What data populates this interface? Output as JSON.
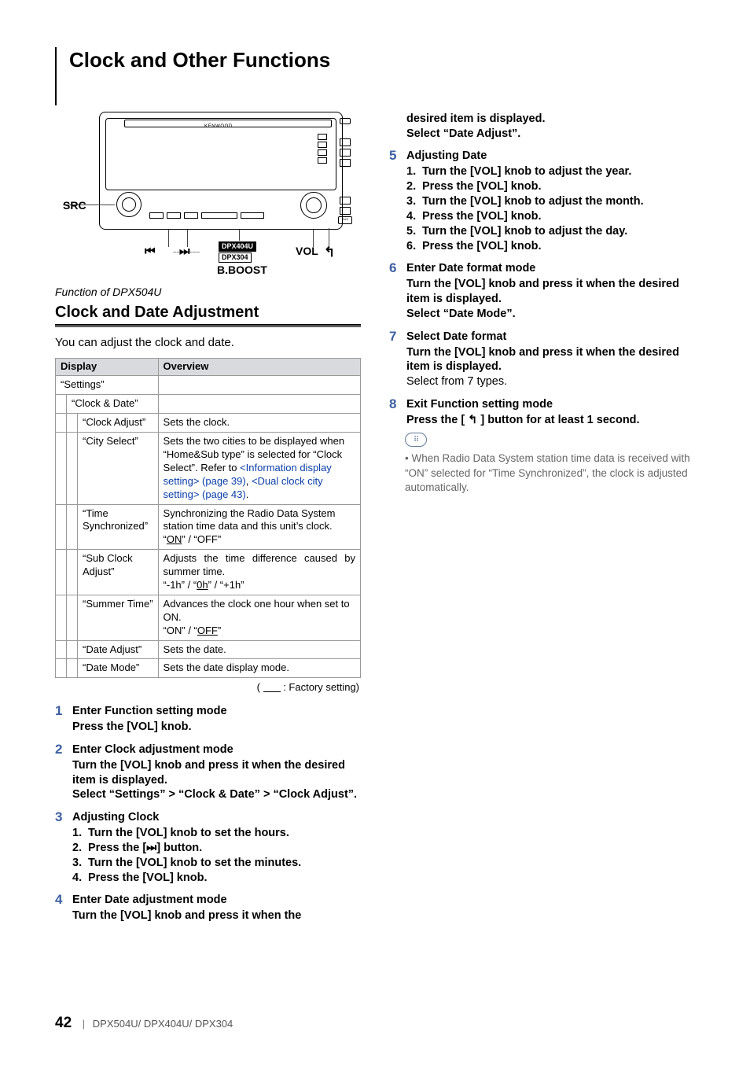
{
  "page": {
    "title": "Clock and Other Functions",
    "number": "42",
    "models_footer": "DPX504U/ DPX404U/ DPX304"
  },
  "device": {
    "brand": "KENWOOD",
    "callouts": {
      "src": "SRC",
      "prev_icon": "⏮",
      "next_icon": "⏭",
      "vol": "VOL",
      "back_icon": "↰",
      "bboost": "B.BOOST"
    },
    "model_badges": [
      "DPX404U",
      "DPX304"
    ]
  },
  "section": {
    "function_of": "Function of DPX504U",
    "heading": "Clock and Date Adjustment",
    "intro": "You can adjust the clock and date.",
    "factory_note_prefix": "( ",
    "factory_note_suffix": " : Factory setting)"
  },
  "table": {
    "headers": {
      "display": "Display",
      "overview": "Overview"
    },
    "root": "“Settings”",
    "group": "“Clock & Date”",
    "rows": [
      {
        "display": "“Clock Adjust”",
        "overview": "Sets the clock."
      },
      {
        "display": "“City Select”",
        "overview_plain_a": "Sets the two cities to be displayed when “Home&Sub type” is selected for “Clock Select”. Refer to ",
        "overview_link_a": "<Information display setting> (page 39)",
        "overview_mid": ", ",
        "overview_link_b": "<Dual clock city setting> (page 43)",
        "overview_end": "."
      },
      {
        "display": "“Time Synchronized”",
        "overview_a": "Synchronizing the Radio Data System station time data and this unit’s clock.",
        "overview_b_pre": "“",
        "overview_b_on": "ON",
        "overview_b_post": "” / “OFF”"
      },
      {
        "display": "“Sub Clock Adjust”",
        "overview_a": "Adjusts the time difference caused by summer time.",
        "overview_b_pre": "“-1h” / “",
        "overview_b_on": "0h",
        "overview_b_post": "” / “+1h”"
      },
      {
        "display": "“Summer Time”",
        "overview_a": "Advances the clock one hour when set to ON.",
        "overview_b_pre": "“ON” / “",
        "overview_b_on": "OFF",
        "overview_b_post": "”"
      },
      {
        "display": "“Date Adjust”",
        "overview": "Sets the date."
      },
      {
        "display": "“Date Mode”",
        "overview": "Sets the date display mode."
      }
    ]
  },
  "steps_left": [
    {
      "n": "1",
      "title": "Enter Function setting mode",
      "lines": [
        "Press the [VOL] knob."
      ]
    },
    {
      "n": "2",
      "title": "Enter Clock adjustment mode",
      "lines": [
        "Turn the [VOL] knob and press it when the desired item is displayed."
      ],
      "select_line": {
        "a": "Select “Settings” ",
        "b": " “Clock & Date” ",
        "c": " “Clock Adjust”."
      }
    },
    {
      "n": "3",
      "title": "Adjusting Clock",
      "subs": [
        {
          "sn": "1.",
          "t": "Turn the [VOL] knob to set the hours."
        },
        {
          "sn": "2.",
          "t_pre": "Press the [",
          "t_icon": "⏭",
          "t_post": "] button."
        },
        {
          "sn": "3.",
          "t": "Turn the [VOL] knob to set the minutes."
        },
        {
          "sn": "4.",
          "t": "Press the [VOL] knob."
        }
      ]
    },
    {
      "n": "4",
      "title": "Enter Date adjustment mode",
      "lines": [
        "Turn the [VOL] knob and press it when the"
      ]
    }
  ],
  "steps_right_pre": {
    "cont_lines": [
      "desired item is displayed.",
      "Select “Date Adjust”."
    ]
  },
  "steps_right": [
    {
      "n": "5",
      "title": "Adjusting Date",
      "subs": [
        {
          "sn": "1.",
          "t": "Turn the [VOL] knob to adjust the year."
        },
        {
          "sn": "2.",
          "t": "Press the [VOL] knob."
        },
        {
          "sn": "3.",
          "t": "Turn the [VOL] knob to adjust the month."
        },
        {
          "sn": "4.",
          "t": "Press the [VOL] knob."
        },
        {
          "sn": "5.",
          "t": "Turn the [VOL] knob to adjust the day."
        },
        {
          "sn": "6.",
          "t": "Press the [VOL] knob."
        }
      ]
    },
    {
      "n": "6",
      "title": "Enter Date format mode",
      "lines": [
        "Turn the [VOL] knob and press it when the desired item is displayed.",
        "Select “Date Mode”."
      ]
    },
    {
      "n": "7",
      "title": "Select Date format",
      "lines": [
        "Turn the [VOL] knob and press it when the desired item is displayed."
      ],
      "sub_plain": "Select from 7 types."
    },
    {
      "n": "8",
      "title": "Exit Function setting mode",
      "line_pre": "Press the [ ",
      "line_icon": "↰",
      "line_post": " ] button for at least 1 second."
    }
  ],
  "note": {
    "text": "When Radio Data System station time data is received with “ON” selected for “Time Synchronized”, the clock is adjusted automatically."
  }
}
